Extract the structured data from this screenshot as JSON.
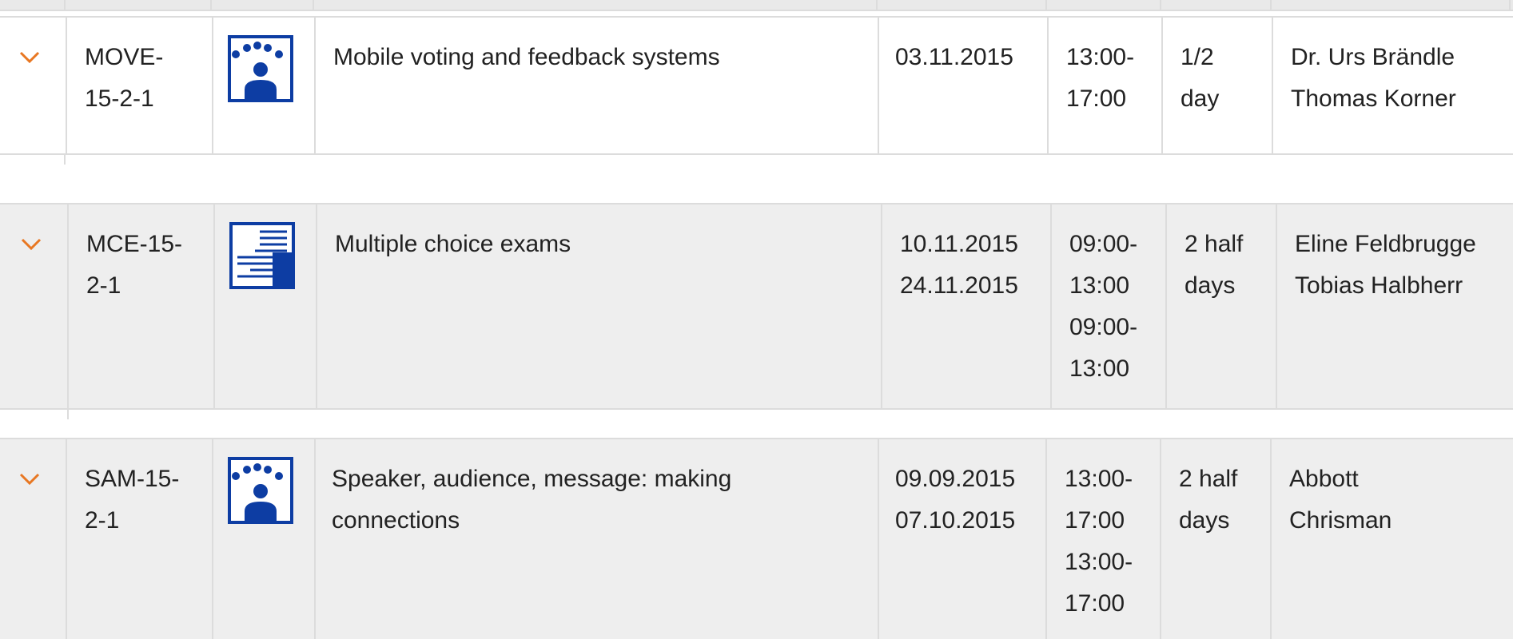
{
  "courses": [
    {
      "code_lines": [
        "MOVE-",
        "15-2-1"
      ],
      "icon": "audience-icon",
      "title_lines": [
        "Mobile voting and feedback systems"
      ],
      "date_lines": [
        "03.11.2015"
      ],
      "time_lines": [
        "13:00-",
        "17:00"
      ],
      "duration_lines": [
        "1/2",
        "day"
      ],
      "instructor_lines": [
        "Dr. Urs Brändle",
        "Thomas Korner"
      ]
    },
    {
      "code_lines": [
        "MCE-15-",
        "2-1"
      ],
      "icon": "exam-sheet-icon",
      "title_lines": [
        "Multiple choice exams"
      ],
      "date_lines": [
        "10.11.2015",
        "24.11.2015"
      ],
      "time_lines": [
        "09:00-",
        "13:00",
        "09:00-",
        "13:00"
      ],
      "duration_lines": [
        "2 half",
        "days"
      ],
      "instructor_lines": [
        "Eline Feldbrugge",
        "Tobias Halbherr"
      ]
    },
    {
      "code_lines": [
        "SAM-15-",
        "2-1"
      ],
      "icon": "audience-icon",
      "title_lines": [
        "Speaker, audience, message: making",
        "connections"
      ],
      "date_lines": [
        "09.09.2015",
        "07.10.2015"
      ],
      "time_lines": [
        "13:00-",
        "17:00",
        "13:00-",
        "17:00"
      ],
      "duration_lines": [
        "2 half",
        "days"
      ],
      "instructor_lines": [
        "Abbott",
        "Chrisman"
      ]
    }
  ],
  "colors": {
    "accent_chevron": "#e87722",
    "icon_blue": "#0d3da3",
    "row_grey": "#eeeeee",
    "border": "#dcdcdc"
  }
}
